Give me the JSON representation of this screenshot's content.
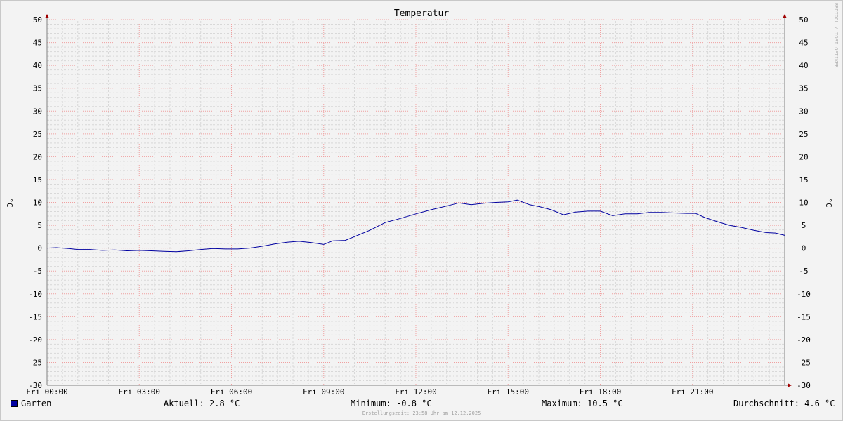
{
  "chart_data": {
    "type": "line",
    "title": "Temperatur",
    "ylabel": "°C",
    "ylabel_right": "°C",
    "ylim": [
      -30,
      50
    ],
    "y_ticks": [
      50,
      45,
      40,
      35,
      30,
      25,
      20,
      15,
      10,
      5,
      0,
      -5,
      -10,
      -15,
      -20,
      -25,
      -30
    ],
    "x_range_hours": [
      0,
      24
    ],
    "x_tick_labels": [
      {
        "h": 0,
        "label": "Fri 00:00"
      },
      {
        "h": 3,
        "label": "Fri 03:00"
      },
      {
        "h": 6,
        "label": "Fri 06:00"
      },
      {
        "h": 9,
        "label": "Fri 09:00"
      },
      {
        "h": 12,
        "label": "Fri 12:00"
      },
      {
        "h": 15,
        "label": "Fri 15:00"
      },
      {
        "h": 18,
        "label": "Fri 18:00"
      },
      {
        "h": 21,
        "label": "Fri 21:00"
      }
    ],
    "grid": true,
    "series": [
      {
        "name": "Garten",
        "color": "#0000a0",
        "points": [
          [
            0.0,
            0.0
          ],
          [
            0.3,
            0.1
          ],
          [
            0.7,
            -0.1
          ],
          [
            1.0,
            -0.3
          ],
          [
            1.4,
            -0.3
          ],
          [
            1.8,
            -0.5
          ],
          [
            2.2,
            -0.4
          ],
          [
            2.6,
            -0.6
          ],
          [
            3.0,
            -0.5
          ],
          [
            3.4,
            -0.6
          ],
          [
            3.8,
            -0.7
          ],
          [
            4.2,
            -0.8
          ],
          [
            4.6,
            -0.6
          ],
          [
            5.0,
            -0.3
          ],
          [
            5.4,
            -0.1
          ],
          [
            5.8,
            -0.2
          ],
          [
            6.2,
            -0.2
          ],
          [
            6.6,
            0.0
          ],
          [
            7.0,
            0.4
          ],
          [
            7.4,
            0.9
          ],
          [
            7.8,
            1.3
          ],
          [
            8.2,
            1.5
          ],
          [
            8.6,
            1.2
          ],
          [
            9.0,
            0.8
          ],
          [
            9.3,
            1.6
          ],
          [
            9.7,
            1.7
          ],
          [
            10.0,
            2.5
          ],
          [
            10.5,
            3.9
          ],
          [
            11.0,
            5.6
          ],
          [
            11.5,
            6.5
          ],
          [
            12.0,
            7.5
          ],
          [
            12.5,
            8.4
          ],
          [
            13.0,
            9.2
          ],
          [
            13.4,
            9.9
          ],
          [
            13.8,
            9.5
          ],
          [
            14.2,
            9.8
          ],
          [
            14.6,
            10.0
          ],
          [
            15.0,
            10.1
          ],
          [
            15.3,
            10.5
          ],
          [
            15.7,
            9.5
          ],
          [
            16.0,
            9.1
          ],
          [
            16.4,
            8.4
          ],
          [
            16.8,
            7.3
          ],
          [
            17.2,
            7.9
          ],
          [
            17.6,
            8.1
          ],
          [
            18.0,
            8.1
          ],
          [
            18.4,
            7.1
          ],
          [
            18.8,
            7.5
          ],
          [
            19.2,
            7.5
          ],
          [
            19.6,
            7.8
          ],
          [
            20.0,
            7.8
          ],
          [
            20.4,
            7.7
          ],
          [
            20.8,
            7.6
          ],
          [
            21.1,
            7.6
          ],
          [
            21.4,
            6.7
          ],
          [
            21.8,
            5.8
          ],
          [
            22.2,
            5.0
          ],
          [
            22.6,
            4.5
          ],
          [
            23.0,
            3.9
          ],
          [
            23.4,
            3.4
          ],
          [
            23.7,
            3.3
          ],
          [
            24.0,
            2.8
          ]
        ]
      }
    ]
  },
  "legend": {
    "name": "Garten",
    "color": "#0000a0"
  },
  "stats": {
    "aktuell_label": "Aktuell: ",
    "aktuell_value": "2.8 °C",
    "min_label": "Minimum: ",
    "min_value": "-0.8 °C",
    "max_label": "Maximum: ",
    "max_value": "10.5 °C",
    "avg_label": "Durchschnitt: ",
    "avg_value": "4.6 °C"
  },
  "footer": "Erstellungszeit: 23:58 Uhr am 12.12.2025",
  "watermark": "RRDTOOL / TOBI OETIKER",
  "colors": {
    "series": "#0000a0",
    "minor_grid": "#d8d8d8",
    "major_grid": "#f0a0a0",
    "axis": "#808080",
    "arrow": "#a00000"
  }
}
